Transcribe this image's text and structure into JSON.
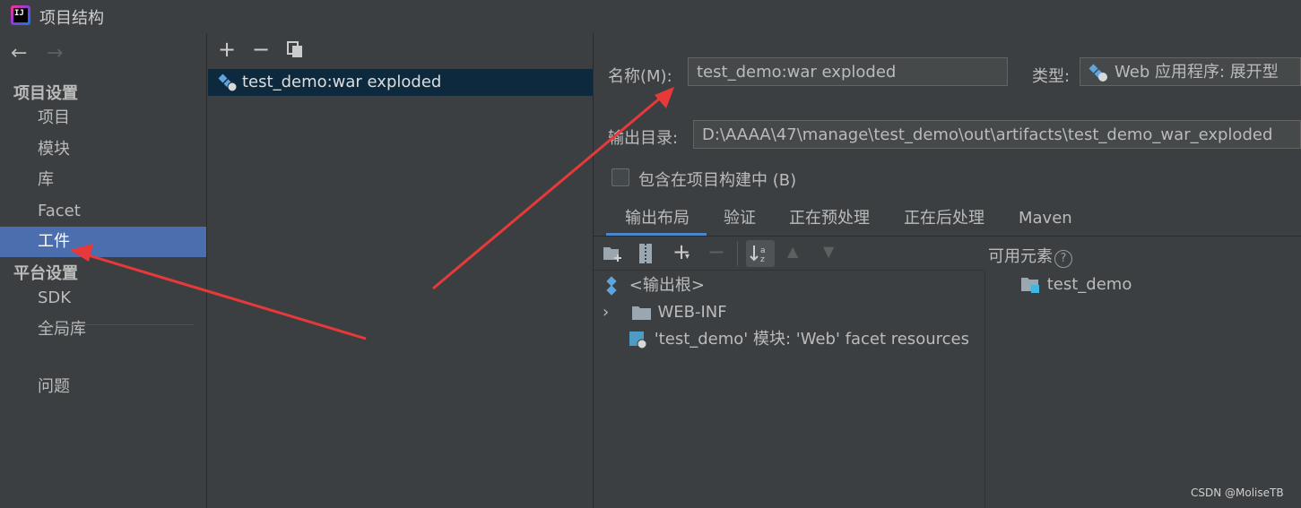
{
  "window": {
    "title": "项目结构",
    "logo_text": "IJ"
  },
  "sidebar": {
    "project_settings_header": "项目设置",
    "project_items": [
      "项目",
      "模块",
      "库",
      "Facet",
      "工件"
    ],
    "selected_index": 4,
    "platform_settings_header": "平台设置",
    "platform_items": [
      "SDK",
      "全局库"
    ],
    "problems": "问题"
  },
  "artifacts": {
    "items": [
      "test_demo:war exploded"
    ]
  },
  "details": {
    "name_label": "名称(M):",
    "name_value": "test_demo:war exploded",
    "type_label": "类型:",
    "type_value": "Web 应用程序: 展开型",
    "output_dir_label": "输出目录:",
    "output_dir_value": "D:\\AAAA\\47\\manage\\test_demo\\out\\artifacts\\test_demo_war_exploded",
    "include_in_build_label": "包含在项目构建中 (B)",
    "tabs": [
      "输出布局",
      "验证",
      "正在预处理",
      "正在后处理",
      "Maven"
    ],
    "active_tab": 0,
    "tree": {
      "root": "<输出根>",
      "web_inf": "WEB-INF",
      "facet_resources": "'test_demo' 模块: 'Web' facet resources"
    },
    "available_title": "可用元素",
    "available_items": [
      "test_demo"
    ]
  },
  "watermark": "CSDN @MoliseTB",
  "colors": {
    "selection": "#4b6eaf",
    "list_selection": "#0d293e",
    "annotation": "#e8393a",
    "accent": "#4a88c7"
  }
}
